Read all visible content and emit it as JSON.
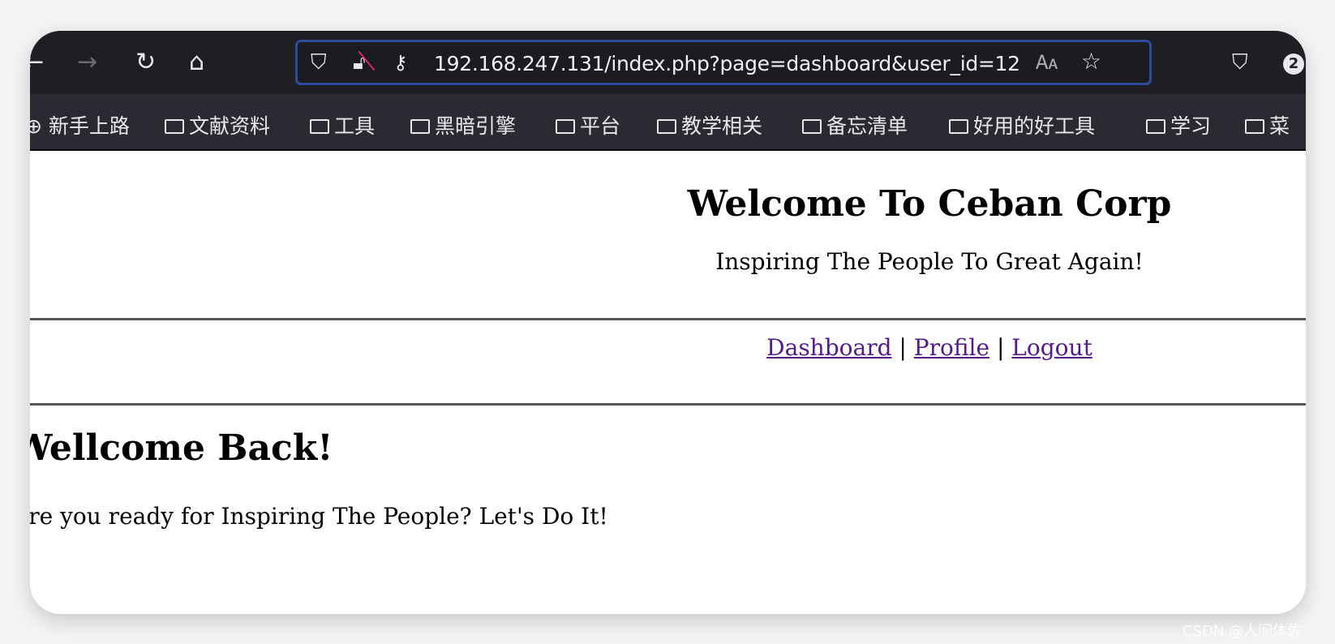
{
  "browser": {
    "url": "192.168.247.131/index.php?page=dashboard&user_id=12",
    "badge_count": "2",
    "icons": [
      "back-icon",
      "forward-icon",
      "reload-icon",
      "home-icon",
      "shield-icon",
      "insecure-lock-icon",
      "key-icon",
      "translate-icon",
      "star-icon",
      "pocket-icon"
    ],
    "bookmarks": [
      "新手上路",
      "文献资料",
      "工具",
      "黑暗引擎",
      "平台",
      "教学相关",
      "备忘清单",
      "好用的好工具",
      "学习",
      "菜"
    ]
  },
  "page": {
    "title": "Welcome To Ceban Corp",
    "subtitle": "Inspiring The People To Great Again!",
    "nav": {
      "dashboard": "Dashboard",
      "sep1": "|",
      "profile": "Profile",
      "sep2": "|",
      "logout": "Logout"
    },
    "heading": "Wellcome Back!",
    "message": "Are you ready for Inspiring The People? Let's Do It!"
  },
  "watermark": "CSDN @人间体佐"
}
